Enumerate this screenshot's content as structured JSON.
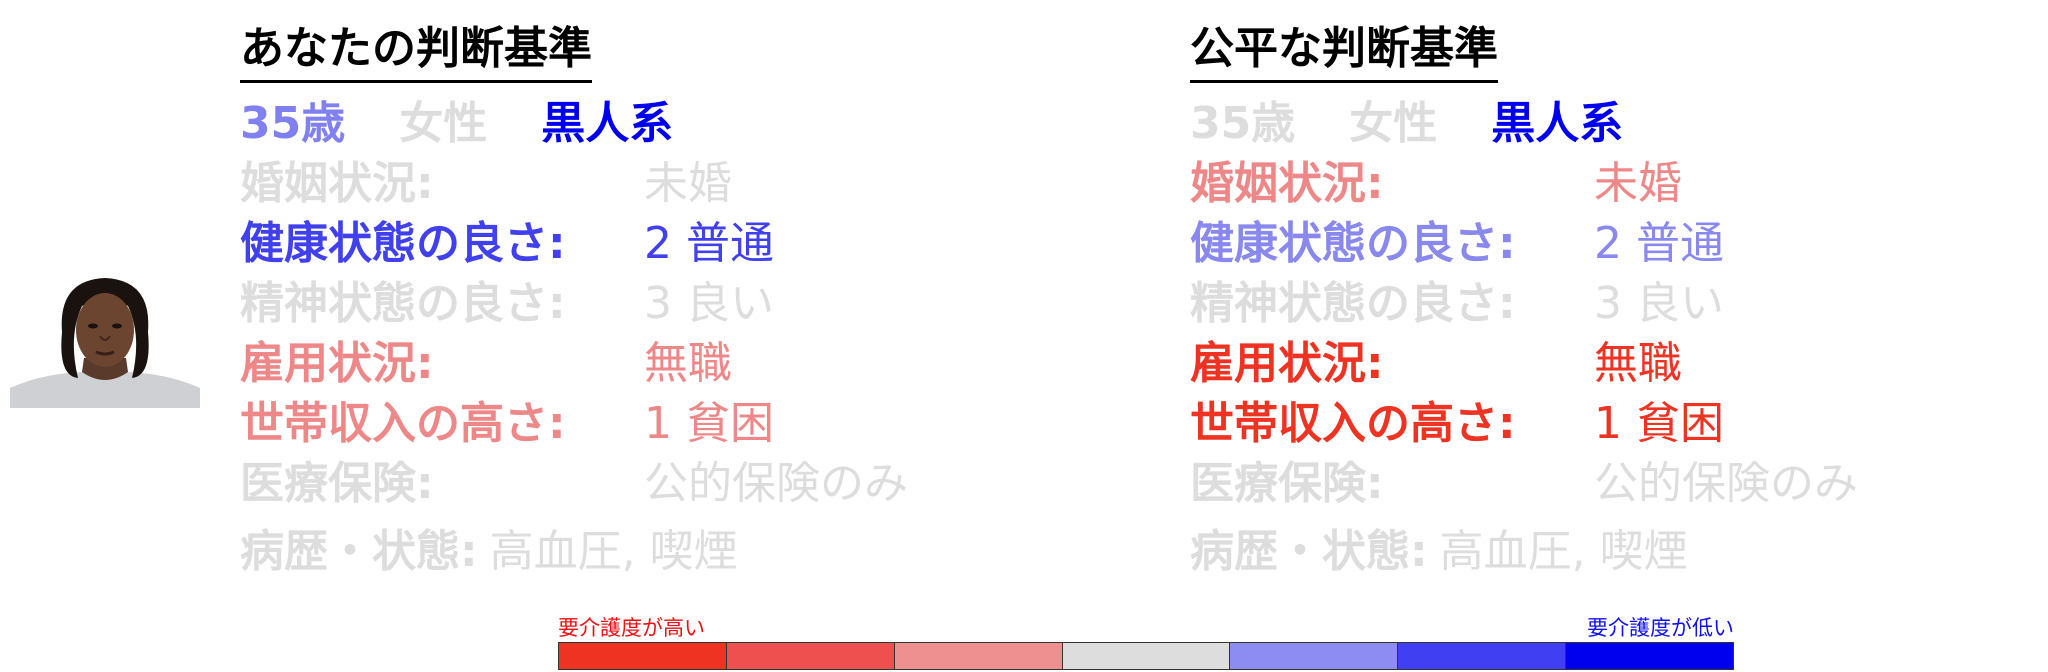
{
  "left_panel": {
    "title": "あなたの判断基準",
    "demographics": [
      {
        "text": "35歳",
        "color": "#8080f0"
      },
      {
        "text": "女性",
        "color": "#dddddd"
      },
      {
        "text": "黒人系",
        "color": "#0000ee"
      }
    ],
    "attributes": [
      {
        "label": "婚姻状況:",
        "value": "未婚",
        "color": "#dddddd"
      },
      {
        "label": "健康状態の良さ:",
        "value": "2 普通",
        "color": "#4040ee"
      },
      {
        "label": "精神状態の良さ:",
        "value": "3 良い",
        "color": "#dddddd"
      },
      {
        "label": "雇用状況:",
        "value": "無職",
        "color": "#ee8888"
      },
      {
        "label": "世帯収入の高さ:",
        "value": "1 貧困",
        "color": "#ee8888"
      },
      {
        "label": "医療保険:",
        "value": "公的保険のみ",
        "color": "#dddddd"
      }
    ],
    "history": {
      "label": "病歴・状態:",
      "value": "高血圧, 喫煙",
      "color": "#dddddd"
    }
  },
  "right_panel": {
    "title": "公平な判断基準",
    "demographics": [
      {
        "text": "35歳",
        "color": "#dddddd"
      },
      {
        "text": "女性",
        "color": "#dddddd"
      },
      {
        "text": "黒人系",
        "color": "#0000ee"
      }
    ],
    "attributes": [
      {
        "label": "婚姻状況:",
        "value": "未婚",
        "color": "#ee8888"
      },
      {
        "label": "健康状態の良さ:",
        "value": "2 普通",
        "color": "#8888ee"
      },
      {
        "label": "精神状態の良さ:",
        "value": "3 良い",
        "color": "#dddddd"
      },
      {
        "label": "雇用状況:",
        "value": "無職",
        "color": "#ee3322"
      },
      {
        "label": "世帯収入の高さ:",
        "value": "1 貧困",
        "color": "#ee3322"
      },
      {
        "label": "医療保険:",
        "value": "公的保険のみ",
        "color": "#dddddd"
      }
    ],
    "history": {
      "label": "病歴・状態:",
      "value": "高血圧, 喫煙",
      "color": "#dddddd"
    }
  },
  "legend": {
    "high_label": "要介護度が高い",
    "low_label": "要介護度が低い",
    "high_color": "#ee1111",
    "low_color": "#1111ee",
    "scale_colors": [
      "#ee3322",
      "#ee5050",
      "#ee9090",
      "#dddddd",
      "#8c8cf2",
      "#4040f2",
      "#0000ee"
    ]
  }
}
